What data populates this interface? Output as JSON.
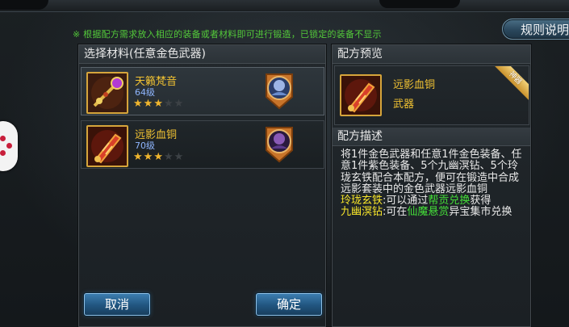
{
  "notice": "※ 根据配方需求放入相应的装备或者材料即可进行锻造，已锁定的装备不显示",
  "rules_button": "规则说明",
  "left_panel": {
    "title": "选择材料(任意金色武器)",
    "items": [
      {
        "name": "天籁梵音",
        "level": "64级",
        "stars": 3,
        "max_stars": 5
      },
      {
        "name": "远影血铜",
        "level": "70级",
        "stars": 3,
        "max_stars": 5
      }
    ],
    "cancel": "取消",
    "confirm": "确定"
  },
  "right_panel": {
    "preview_title": "配方预览",
    "preview_name": "远影血铜",
    "preview_type": "武器",
    "ribbon": "神器",
    "desc_title": "配方描述",
    "desc_main": "将1件金色武器和任意1件金色装备、任意1件紫色装备、5个九幽溟钻、5个玲珑玄铁配合本配方，便可在锻造中合成远影套装中的金色武器远影血铜",
    "mat1_name": "玲珑玄铁",
    "mat1_text1": ":可以通过",
    "mat1_link": "帮贡兑换",
    "mat1_text2": "获得",
    "mat2_name": "九幽溟钻",
    "mat2_text1": ":可在",
    "mat2_link": "仙魔悬赏",
    "mat2_text2": "异宝集市兑换"
  }
}
